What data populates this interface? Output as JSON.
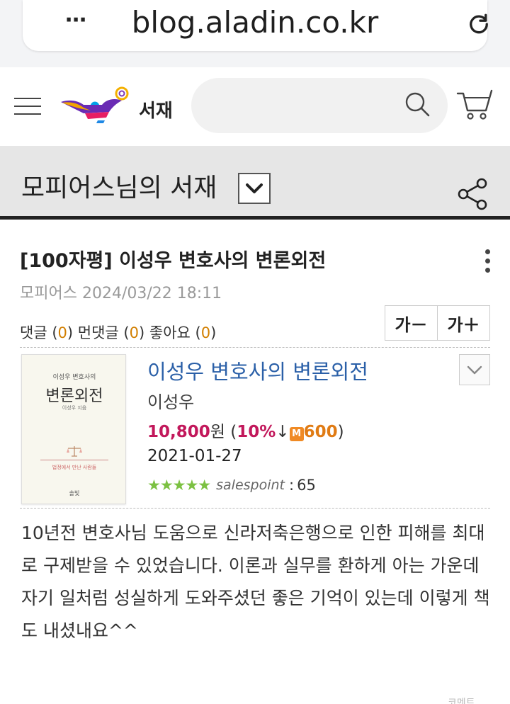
{
  "browser": {
    "url": "blog.aladin.co.kr",
    "menu_glyph": "⋯"
  },
  "header": {
    "logo_text": "서재",
    "search_placeholder": ""
  },
  "library": {
    "title": "모피어스님의 서재"
  },
  "post": {
    "title": "[100자평] 이성우 변호사의 변론외전",
    "author": "모피어스",
    "datetime": "2024/03/22 18:11",
    "stats": {
      "comments_label": "댓글",
      "comments": "0",
      "trackbacks_label": "먼댓글",
      "trackbacks": "0",
      "likes_label": "좋아요",
      "likes": "0"
    },
    "font_smaller": "가－",
    "font_larger": "가＋"
  },
  "book": {
    "title": "이성우 변호사의 변론외전",
    "author": "이성우",
    "price": "10,800",
    "price_unit": "원",
    "discount": "10%",
    "mileage_badge": "M",
    "mileage": "600",
    "date": "2021-01-27",
    "rating_stars": "★★★★★",
    "rating_value": 5,
    "salespoint_label": "salespoint",
    "salespoint": "65",
    "cover": {
      "small_line": "이성우 변호사의",
      "title": "변론외전",
      "sub": "이성우 지음",
      "note": "법정에서 만난 사람들",
      "publisher": "솔빛"
    }
  },
  "review": {
    "text": "10년전 변호사님 도움으로 신라저축은행으로 인한 피해를 최대로 구제받을 수 있었습니다. 이론과 실무를 환하게 아는 가운데 자기 일처럼 성실하게 도와주셨던 좋은 기억이 있는데 이렇게 책도 내셨내요^^"
  },
  "footer": {
    "hint": "코멘트"
  },
  "colors": {
    "link_blue": "#2b60a8",
    "price_magenta": "#c2185b",
    "mileage_orange": "#f08a24",
    "star_green": "#7cc142"
  }
}
